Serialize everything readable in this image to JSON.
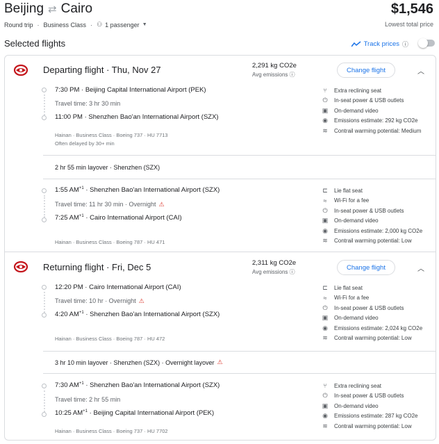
{
  "header": {
    "origin": "Beijing",
    "destination": "Cairo",
    "price": "$1,546",
    "price_note": "Lowest total price",
    "trip_type": "Round trip",
    "cabin": "Business Class",
    "passengers": "1 passenger"
  },
  "section": {
    "title": "Selected flights",
    "track_prices": "Track prices"
  },
  "departing": {
    "title": "Departing flight",
    "date": "Thu, Nov 27",
    "emissions": "2,291 kg CO2e",
    "avg": "Avg emissions",
    "change": "Change flight",
    "seg1": {
      "dep_time": "7:30 PM",
      "dep_airport": "Beijing Capital International Airport (PEK)",
      "travel": "Travel time: 3 hr 30 min",
      "arr_time": "11:00 PM",
      "arr_airport": "Shenzhen Bao'an International Airport (SZX)",
      "meta": "Hainan · Business Class · Boeing 737 · HU 7713",
      "delay": "Often delayed by 30+ min",
      "amenities": [
        "Extra reclining seat",
        "In-seat power & USB outlets",
        "On-demand video",
        "Emissions estimate: 292 kg CO2e",
        "Contrail warming potential: Medium"
      ]
    },
    "layover": "2 hr 55 min layover · Shenzhen (SZX)",
    "seg2": {
      "dep_time": "1:55 AM",
      "dep_sup": "+1",
      "dep_airport": "Shenzhen Bao'an International Airport (SZX)",
      "travel": "Travel time: 11 hr 30 min · Overnight",
      "arr_time": "7:25 AM",
      "arr_sup": "+1",
      "arr_airport": "Cairo International Airport (CAI)",
      "meta": "Hainan · Business Class · Boeing 787 · HU 471",
      "amenities": [
        "Lie flat seat",
        "Wi-Fi for a fee",
        "In-seat power & USB outlets",
        "On-demand video",
        "Emissions estimate: 2,000 kg CO2e",
        "Contrail warming potential: Low"
      ]
    }
  },
  "returning": {
    "title": "Returning flight",
    "date": "Fri, Dec 5",
    "emissions": "2,311 kg CO2e",
    "avg": "Avg emissions",
    "change": "Change flight",
    "seg1": {
      "dep_time": "12:20 PM",
      "dep_airport": "Cairo International Airport (CAI)",
      "travel": "Travel time: 10 hr · Overnight",
      "arr_time": "4:20 AM",
      "arr_sup": "+1",
      "arr_airport": "Shenzhen Bao'an International Airport (SZX)",
      "meta": "Hainan · Business Class · Boeing 787 · HU 472",
      "amenities": [
        "Lie flat seat",
        "Wi-Fi for a fee",
        "In-seat power & USB outlets",
        "On-demand video",
        "Emissions estimate: 2,024 kg CO2e",
        "Contrail warming potential: Low"
      ]
    },
    "layover": "3 hr 10 min layover · Shenzhen (SZX) · Overnight layover",
    "seg2": {
      "dep_time": "7:30 AM",
      "dep_sup": "+1",
      "dep_airport": "Shenzhen Bao'an International Airport (SZX)",
      "travel": "Travel time: 2 hr 55 min",
      "arr_time": "10:25 AM",
      "arr_sup": "+1",
      "arr_airport": "Beijing Capital International Airport (PEK)",
      "meta": "Hainan · Business Class · Boeing 737 · HU 7702",
      "amenities": [
        "Extra reclining seat",
        "In-seat power & USB outlets",
        "On-demand video",
        "Emissions estimate: 287 kg CO2e",
        "Contrail warming potential: Low"
      ]
    }
  },
  "icons": {
    "brand_red": "#c4161c",
    "link_blue": "#1a73e8",
    "warning_red": "#d93025"
  }
}
